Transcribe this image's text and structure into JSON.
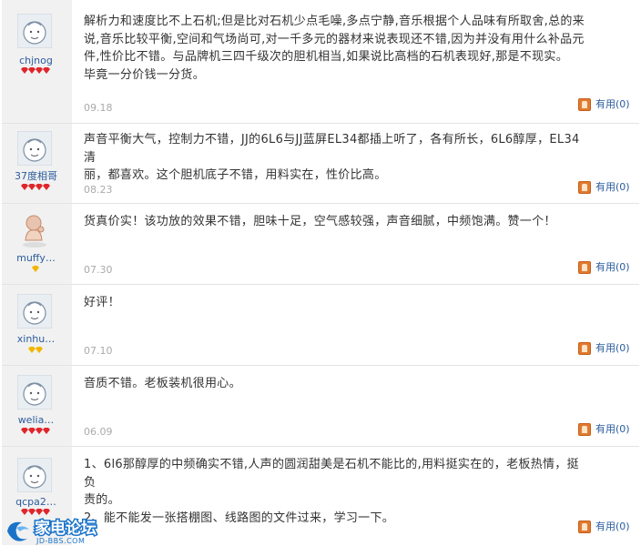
{
  "reviews": [
    {
      "user": "chjnog",
      "avatar": "baby-face-avatar",
      "badge": "red-gem",
      "badge_count": 4,
      "text": [
        "解析力和速度比不上石机;但是比对石机少点毛噪,多点宁静,音乐根据个人品味有所取舍,总的来",
        "说,音乐比较平衡,空间和气场尚可,对一千多元的器材来说表现还不错,因为并没有用什么补品元",
        "件,性价比不错。与品牌机三四千级次的胆机相当,如果说比高档的石机表现好,那是不现实。",
        "毕竟一分价钱一分货。"
      ],
      "date": "09.18",
      "useful": "有用(0)"
    },
    {
      "user": "37度相哥",
      "avatar": "baby-face-avatar",
      "badge": "red-gem",
      "badge_count": 4,
      "text": [
        "声音平衡大气，控制力不错，JJ的6L6与JJ蓝屏EL34都插上听了，各有所长，6L6醇厚，EL34清",
        "丽，都喜欢。这个胆机底子不错，用料实在，性价比高。"
      ],
      "date": "08.23",
      "useful": "有用(0)"
    },
    {
      "user": "muffy…",
      "avatar": "thinking-figure-avatar",
      "badge": "yellow-gem",
      "badge_count": 1,
      "text": [
        "货真价实！该功放的效果不错，胆味十足，空气感较强，声音细腻，中频饱满。赞一个！"
      ],
      "date": "07.30",
      "useful": "有用(0)"
    },
    {
      "user": "xinhu…",
      "avatar": "baby-face-avatar",
      "badge": "yellow-gem",
      "badge_count": 2,
      "text": [
        "好评！"
      ],
      "date": "07.10",
      "useful": "有用(0)"
    },
    {
      "user": "welia…",
      "avatar": "baby-face-avatar",
      "badge": "red-gem",
      "badge_count": 4,
      "text": [
        "音质不错。老板装机很用心。"
      ],
      "date": "06.09",
      "useful": "有用(0)"
    },
    {
      "user": "qcpa2…",
      "avatar": "baby-face-avatar",
      "badge": "red-gem",
      "badge_count": 4,
      "text": [
        "1、6l6那醇厚的中频确实不错,人声的圆润甜美是石机不能比的,用料挺实在的，老板热情，挺负",
        "责的。",
        "2、能不能发一张搭棚图、线路图的文件过来，学习一下。"
      ],
      "date": "",
      "useful": "有用(0)"
    }
  ],
  "watermark": {
    "name": "家电论坛",
    "domain": "JD-BBS.COM"
  },
  "colors": {
    "sidebar": "#f1f1f1",
    "link": "#2b5c9c",
    "date": "#aaaaaa",
    "gem_red": "#e0262b",
    "gem_yellow": "#f2b600",
    "useful_icon": "#e07a2f"
  }
}
